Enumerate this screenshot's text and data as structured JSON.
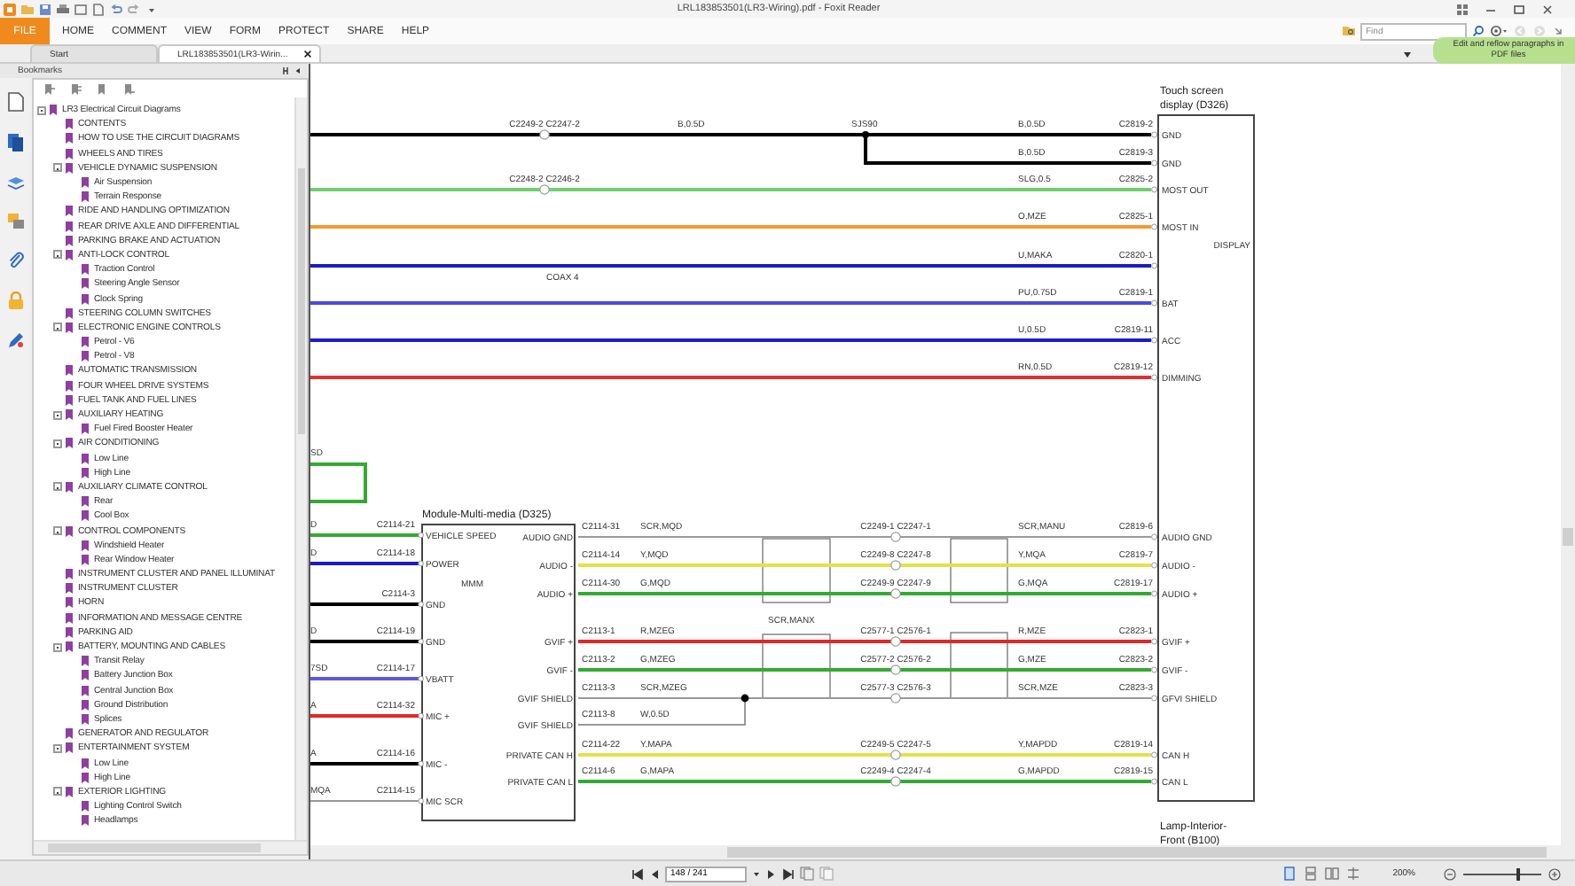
{
  "window": {
    "title": "LRL183853501(LR3-Wiring).pdf - Foxit Reader"
  },
  "menu": [
    {
      "label": "FILE",
      "kind": "file"
    },
    {
      "label": "HOME",
      "kind": "tab"
    },
    {
      "label": "COMMENT",
      "kind": "tab"
    },
    {
      "label": "VIEW",
      "kind": "tab"
    },
    {
      "label": "FORM",
      "kind": "tab"
    },
    {
      "label": "PROTECT",
      "kind": "tab"
    },
    {
      "label": "SHARE",
      "kind": "tab"
    },
    {
      "label": "HELP",
      "kind": "tab"
    }
  ],
  "find": {
    "placeholder": "Find"
  },
  "tooltip": {
    "text": "Edit and reflow paragraphs in PDF files"
  },
  "tabs": [
    {
      "label": "Start",
      "selected": false,
      "closable": false
    },
    {
      "label": "LRL183853501(LR3-Wirin...",
      "selected": true,
      "closable": true
    }
  ],
  "bookmarks": {
    "title": "Bookmarks",
    "items": [
      {
        "label": "LR3 Electrical Circuit Diagrams",
        "expanded": true,
        "children": [
          {
            "label": "CONTENTS"
          },
          {
            "label": "HOW TO USE THE CIRCUIT DIAGRAMS"
          },
          {
            "label": "WHEELS AND TIRES"
          },
          {
            "label": "VEHICLE DYNAMIC SUSPENSION",
            "expanded": true,
            "children": [
              {
                "label": "Air Suspension"
              },
              {
                "label": "Terrain Response"
              }
            ]
          },
          {
            "label": "RIDE AND HANDLING OPTIMIZATION"
          },
          {
            "label": "REAR DRIVE AXLE AND DIFFERENTIAL"
          },
          {
            "label": "PARKING BRAKE AND ACTUATION"
          },
          {
            "label": "ANTI-LOCK CONTROL",
            "expanded": true,
            "children": [
              {
                "label": "Traction Control"
              },
              {
                "label": "Steering Angle Sensor"
              },
              {
                "label": "Clock Spring"
              }
            ]
          },
          {
            "label": "STEERING COLUMN SWITCHES"
          },
          {
            "label": "ELECTRONIC ENGINE CONTROLS",
            "expanded": true,
            "children": [
              {
                "label": "Petrol - V6"
              },
              {
                "label": "Petrol - V8"
              }
            ]
          },
          {
            "label": "AUTOMATIC TRANSMISSION"
          },
          {
            "label": "FOUR WHEEL DRIVE SYSTEMS"
          },
          {
            "label": "FUEL TANK AND FUEL LINES"
          },
          {
            "label": "AUXILIARY HEATING",
            "expanded": true,
            "children": [
              {
                "label": "Fuel Fired Booster Heater"
              }
            ]
          },
          {
            "label": "AIR CONDITIONING",
            "expanded": true,
            "children": [
              {
                "label": "Low Line"
              },
              {
                "label": "High Line"
              }
            ]
          },
          {
            "label": "AUXILIARY CLIMATE CONTROL",
            "expanded": true,
            "children": [
              {
                "label": "Rear"
              },
              {
                "label": "Cool Box"
              }
            ]
          },
          {
            "label": "CONTROL COMPONENTS",
            "expanded": true,
            "children": [
              {
                "label": "Windshield Heater"
              },
              {
                "label": "Rear Window Heater"
              }
            ]
          },
          {
            "label": "INSTRUMENT CLUSTER AND PANEL ILLUMINAT"
          },
          {
            "label": "INSTRUMENT CLUSTER"
          },
          {
            "label": "HORN"
          },
          {
            "label": "INFORMATION AND MESSAGE CENTRE"
          },
          {
            "label": "PARKING AID"
          },
          {
            "label": "BATTERY, MOUNTING AND CABLES",
            "expanded": true,
            "children": [
              {
                "label": "Transit Relay"
              },
              {
                "label": "Battery Junction Box"
              },
              {
                "label": "Central Junction Box"
              },
              {
                "label": "Ground Distribution"
              },
              {
                "label": "Splices"
              }
            ]
          },
          {
            "label": "GENERATOR AND REGULATOR"
          },
          {
            "label": "ENTERTAINMENT SYSTEM",
            "expanded": true,
            "children": [
              {
                "label": "Low Line"
              },
              {
                "label": "High Line"
              }
            ]
          },
          {
            "label": "EXTERIOR LIGHTING",
            "expanded": true,
            "children": [
              {
                "label": "Lighting Control Switch"
              },
              {
                "label": "Headlamps"
              }
            ]
          }
        ]
      }
    ]
  },
  "diagram": {
    "display": {
      "title": [
        "Touch screen",
        "display (D326)"
      ],
      "function": "DISPLAY"
    },
    "module": {
      "title": "Module-Multi-media (D325)",
      "function": "MMM"
    },
    "lamp": {
      "title": [
        "Lamp-Interior-",
        "Front (B100)"
      ]
    },
    "loop": {
      "label": "SD",
      "color": "#33aa33"
    },
    "shield_label": "SCR,MANX",
    "display_wires": [
      {
        "kind": "wire",
        "color": "#000000",
        "inline": "C2249-2 C2247-2",
        "code_left": "B,0.5D",
        "splice": "SJS90",
        "code": "B,0.5D",
        "pin": "C2819-2",
        "pin_name": "GND"
      },
      {
        "kind": "branch",
        "color": "#000000",
        "code": "B,0.5D",
        "pin": "C2819-3",
        "pin_name": "GND"
      },
      {
        "kind": "wire",
        "color": "#6fcf6f",
        "inline": "C2248-2 C2246-2",
        "code": "SLG,0.5",
        "pin": "C2825-2",
        "pin_name": "MOST OUT"
      },
      {
        "kind": "wire",
        "color": "#f39a2e",
        "code": "O,MZE",
        "pin": "C2825-1",
        "pin_name": "MOST IN"
      },
      {
        "kind": "wire",
        "color": "#1c1cc0",
        "note": "COAX 4",
        "code": "U,MAKA",
        "pin": "C2820-1"
      },
      {
        "kind": "wire",
        "color": "#4a4ae0",
        "code": "PU,0.75D",
        "pin": "C2819-1",
        "pin_name": "BAT"
      },
      {
        "kind": "wire",
        "color": "#1c1cc8",
        "code": "U,0.5D",
        "pin": "C2819-11",
        "pin_name": "ACC"
      },
      {
        "kind": "wire",
        "color": "#e03030",
        "code": "RN,0.5D",
        "pin": "C2819-12",
        "pin_name": "DIMMING"
      }
    ],
    "module_wires": [
      {
        "kind": "screen",
        "color": "#999999",
        "module_pin_name": "AUDIO GND",
        "module_pin": "C2114-31",
        "code_left": "SCR,MQD",
        "inline": "C2249-1 C2247-1",
        "code": "SCR,MANU",
        "pin": "C2819-6",
        "pin_name": "AUDIO GND"
      },
      {
        "kind": "wire",
        "color": "#e6e04a",
        "module_pin_name": "AUDIO -",
        "module_pin": "C2114-14",
        "code_left": "Y,MQD",
        "inline": "C2249-8 C2247-8",
        "code": "Y,MQA",
        "pin": "C2819-7",
        "pin_name": "AUDIO -"
      },
      {
        "kind": "wire",
        "color": "#33aa33",
        "module_pin_name": "AUDIO +",
        "module_pin": "C2114-30",
        "code_left": "G,MQD",
        "inline": "C2249-9 C2247-9",
        "code": "G,MQA",
        "pin": "C2819-17",
        "pin_name": "AUDIO +"
      },
      {
        "kind": "wire",
        "color": "#e02828",
        "module_pin_name": "GVIF +",
        "module_pin": "C2113-1",
        "code_left": "R,MZEG",
        "inline": "C2577-1 C2576-1",
        "code": "R,MZE",
        "pin": "C2823-1",
        "pin_name": "GVIF +"
      },
      {
        "kind": "wire",
        "color": "#33aa33",
        "module_pin_name": "GVIF -",
        "module_pin": "C2113-2",
        "code_left": "G,MZEG",
        "inline": "C2577-2 C2576-2",
        "code": "G,MZE",
        "pin": "C2823-2",
        "pin_name": "GVIF -"
      },
      {
        "kind": "screen",
        "color": "#999999",
        "module_pin_name": "GVIF SHIELD",
        "module_pin": "C2113-3",
        "code_left": "SCR,MZEG",
        "inline": "C2577-3 C2576-3",
        "code": "SCR,MZE",
        "pin": "C2823-3",
        "pin_name": "GFVI SHIELD"
      },
      {
        "kind": "drain",
        "color": "#999999",
        "module_pin_name": "GVIF SHIELD",
        "module_pin": "C2113-8",
        "code_left": "W,0.5D"
      },
      {
        "kind": "wire",
        "color": "#e6e04a",
        "module_pin_name": "PRIVATE CAN H",
        "module_pin": "C2114-22",
        "code_left": "Y,MAPA",
        "inline": "C2249-5 C2247-5",
        "code": "Y,MAPDD",
        "pin": "C2819-14",
        "pin_name": "CAN H"
      },
      {
        "kind": "wire",
        "color": "#33aa33",
        "module_pin_name": "PRIVATE CAN L",
        "module_pin": "C2114-6",
        "code_left": "G,MAPA",
        "inline": "C2249-4 C2247-4",
        "code": "G,MAPDD",
        "pin": "C2819-15",
        "pin_name": "CAN L"
      }
    ],
    "module_inputs": [
      {
        "kind": "wire",
        "color": "#33aa33",
        "cut_label": "D",
        "pin": "C2114-21",
        "pin_name": "VEHICLE SPEED"
      },
      {
        "kind": "wire",
        "color": "#1c1cc0",
        "cut_label": "D",
        "pin": "C2114-18",
        "pin_name": "POWER"
      },
      {
        "kind": "wire",
        "color": "#000000",
        "pin": "C2114-3",
        "pin_name": "GND"
      },
      {
        "kind": "wire",
        "color": "#000000",
        "cut_label": "D",
        "pin": "C2114-19",
        "pin_name": "GND"
      },
      {
        "kind": "wire",
        "color": "#5a5ae0",
        "cut_label": "7SD",
        "pin": "C2114-17",
        "pin_name": "VBATT"
      },
      {
        "kind": "wire",
        "color": "#e02828",
        "cut_label": "A",
        "pin": "C2114-32",
        "pin_name": "MIC +"
      },
      {
        "kind": "wire",
        "color": "#000000",
        "cut_label": "A",
        "pin": "C2114-16",
        "pin_name": "MIC -"
      },
      {
        "kind": "screen",
        "color": "#999999",
        "cut_label": "MQA",
        "pin": "C2114-15",
        "pin_name": "MIC SCR"
      }
    ]
  },
  "status_bar": {
    "page": "148 / 241",
    "zoom": "200%",
    "zoom_slider": {
      "level": 0.7
    }
  }
}
